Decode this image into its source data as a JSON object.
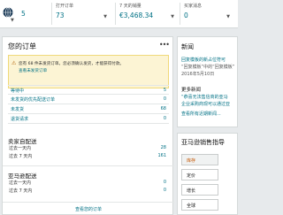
{
  "header": {
    "global_value": "5",
    "metrics": [
      {
        "label": "打开订单",
        "value": "73"
      },
      {
        "label": "7 天的销量",
        "value": "€3,468.34"
      },
      {
        "label": "买家消息",
        "value": "0"
      }
    ]
  },
  "orders": {
    "title": "您的订单",
    "menu": "•••",
    "alert_text": "您有 68 件未发货订单。您必须确认发货，才能获得付款。",
    "alert_link": "查看未发货订单",
    "rows": [
      {
        "label": "等待中",
        "value": "5"
      },
      {
        "label": "未发货的优先配送订单",
        "value": "0"
      },
      {
        "label": "未发货",
        "value": "68"
      },
      {
        "label": "退货请求",
        "value": "0"
      }
    ],
    "seller_fulfilled": {
      "title": "卖家自配送",
      "rows": [
        {
          "label": "过去一天内",
          "value": "28"
        },
        {
          "label": "过去 7 天内",
          "value": "161"
        }
      ]
    },
    "amazon_fulfilled": {
      "title": "亚马逊配送",
      "rows": [
        {
          "label": "过去一天内",
          "value": "0"
        },
        {
          "label": "过去 7 天内",
          "value": "0"
        }
      ]
    },
    "footer_link": "查看您的订单"
  },
  "news": {
    "title": "新闻",
    "main_line1": "回复模板的新占位符可",
    "main_line2": "“回复模板”中的“回复模板”",
    "date": "2016年5月10日",
    "more_title": "更多新闻",
    "more_item_line1": "“恭喜无法售信商的亚马",
    "more_item_line2": "企业采购商现可以通过亚",
    "more_link": "查看所有近期新闻..."
  },
  "guide": {
    "title": "亚马逊销售指导",
    "buttons": [
      "库存",
      "定价",
      "增长",
      "全球"
    ]
  }
}
